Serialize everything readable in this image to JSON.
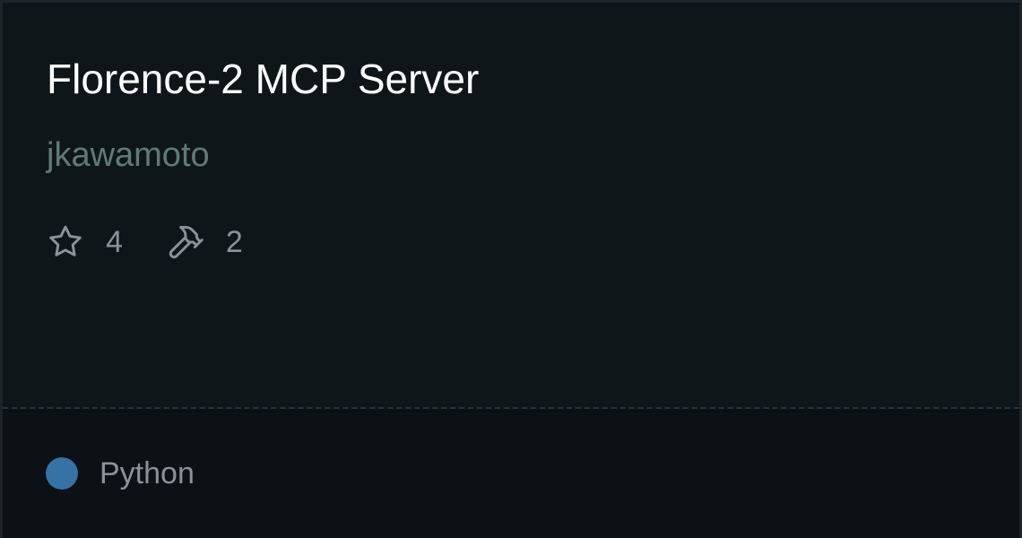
{
  "repo": {
    "title": "Florence-2 MCP Server",
    "author": "jkawamoto"
  },
  "stats": {
    "stars": {
      "icon": "star-icon",
      "count": "4"
    },
    "tools": {
      "icon": "hammer-icon",
      "count": "2"
    }
  },
  "footer": {
    "language": "Python",
    "language_color": "#3572a5"
  },
  "colors": {
    "background": "#0f1619",
    "title": "#ffffff",
    "author": "#5f7b76",
    "muted_text": "#8a9397",
    "footer_background": "#0b1114"
  }
}
